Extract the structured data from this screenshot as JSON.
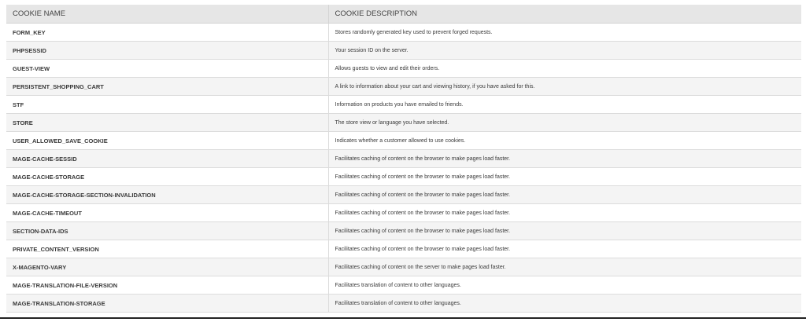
{
  "table": {
    "headers": {
      "name": "COOKIE NAME",
      "description": "COOKIE DESCRIPTION"
    },
    "rows": [
      {
        "name": "FORM_KEY",
        "description": "Stores randomly generated key used to prevent forged requests."
      },
      {
        "name": "PHPSESSID",
        "description": "Your session ID on the server."
      },
      {
        "name": "GUEST-VIEW",
        "description": "Allows guests to view and edit their orders."
      },
      {
        "name": "PERSISTENT_SHOPPING_CART",
        "description": "A link to information about your cart and viewing history, if you have asked for this."
      },
      {
        "name": "STF",
        "description": "Information on products you have emailed to friends."
      },
      {
        "name": "STORE",
        "description": "The store view or language you have selected."
      },
      {
        "name": "USER_ALLOWED_SAVE_COOKIE",
        "description": "Indicates whether a customer allowed to use cookies."
      },
      {
        "name": "MAGE-CACHE-SESSID",
        "description": "Facilitates caching of content on the browser to make pages load faster."
      },
      {
        "name": "MAGE-CACHE-STORAGE",
        "description": "Facilitates caching of content on the browser to make pages load faster."
      },
      {
        "name": "MAGE-CACHE-STORAGE-SECTION-INVALIDATION",
        "description": "Facilitates caching of content on the browser to make pages load faster."
      },
      {
        "name": "MAGE-CACHE-TIMEOUT",
        "description": "Facilitates caching of content on the browser to make pages load faster."
      },
      {
        "name": "SECTION-DATA-IDS",
        "description": "Facilitates caching of content on the browser to make pages load faster."
      },
      {
        "name": "PRIVATE_CONTENT_VERSION",
        "description": "Facilitates caching of content on the browser to make pages load faster."
      },
      {
        "name": "X-MAGENTO-VARY",
        "description": "Facilitates caching of content on the server to make pages load faster."
      },
      {
        "name": "MAGE-TRANSLATION-FILE-VERSION",
        "description": "Facilitates translation of content to other languages."
      },
      {
        "name": "MAGE-TRANSLATION-STORAGE",
        "description": "Facilitates translation of content to other languages."
      }
    ]
  }
}
